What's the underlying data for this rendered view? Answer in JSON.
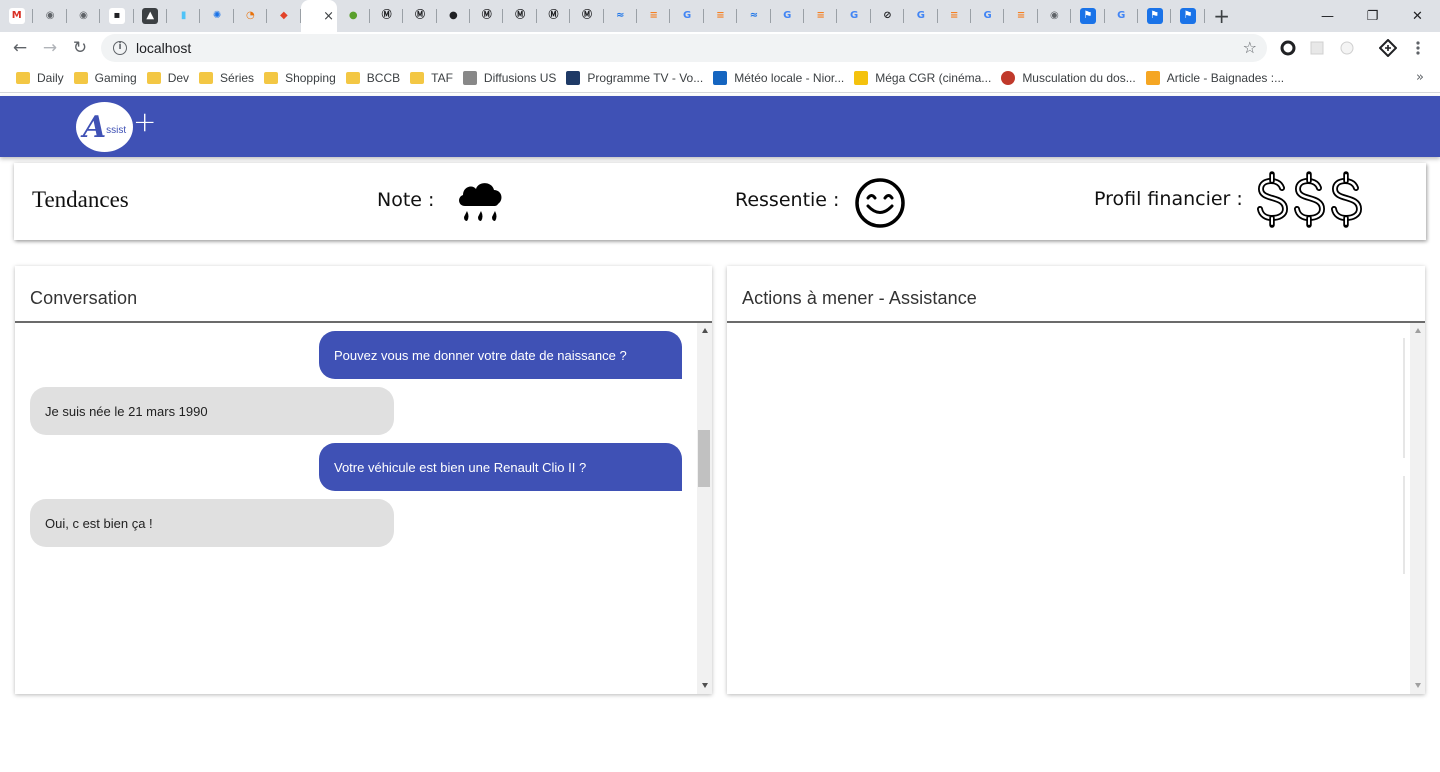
{
  "browser": {
    "tabs": [
      {
        "icon": "gmail-icon",
        "glyph": "M",
        "color": "#d93025",
        "bg": "#ffffff"
      },
      {
        "icon": "globe-icon",
        "glyph": "◉",
        "color": "#5f6368",
        "bg": "transparent"
      },
      {
        "icon": "globe-icon",
        "glyph": "◉",
        "color": "#5f6368",
        "bg": "transparent"
      },
      {
        "icon": "page-icon",
        "glyph": "▪",
        "color": "#202124",
        "bg": "#ffffff"
      },
      {
        "icon": "image-icon",
        "glyph": "▲",
        "color": "#ffffff",
        "bg": "#3c4043"
      },
      {
        "icon": "tube-icon",
        "glyph": "▮",
        "color": "#4fc3f7",
        "bg": "transparent"
      },
      {
        "icon": "chip-icon",
        "glyph": "✺",
        "color": "#1a73e8",
        "bg": "transparent"
      },
      {
        "icon": "clock-fox-icon",
        "glyph": "◔",
        "color": "#e8710a",
        "bg": "transparent"
      },
      {
        "icon": "gitlab-icon",
        "glyph": "◆",
        "color": "#e24329",
        "bg": "transparent"
      },
      {
        "icon": "blank-icon",
        "glyph": "",
        "color": "#5f6368",
        "bg": "transparent"
      },
      {
        "icon": "ball-icon",
        "glyph": "●",
        "color": "#5aa02c",
        "bg": "transparent"
      },
      {
        "icon": "m-circle-icon",
        "glyph": "Ⓜ",
        "color": "#202124",
        "bg": "transparent"
      },
      {
        "icon": "m-circle-icon",
        "glyph": "Ⓜ",
        "color": "#202124",
        "bg": "transparent"
      },
      {
        "icon": "github-icon",
        "glyph": "●",
        "color": "#202124",
        "bg": "transparent"
      },
      {
        "icon": "m-circle-icon",
        "glyph": "Ⓜ",
        "color": "#202124",
        "bg": "transparent"
      },
      {
        "icon": "m-circle-icon",
        "glyph": "Ⓜ",
        "color": "#202124",
        "bg": "transparent"
      },
      {
        "icon": "m-circle-icon",
        "glyph": "Ⓜ",
        "color": "#202124",
        "bg": "transparent"
      },
      {
        "icon": "m-circle-icon",
        "glyph": "Ⓜ",
        "color": "#202124",
        "bg": "transparent"
      },
      {
        "icon": "wave-icon",
        "glyph": "≈",
        "color": "#1a73e8",
        "bg": "transparent"
      },
      {
        "icon": "stackoverflow-icon",
        "glyph": "≡",
        "color": "#f48024",
        "bg": "transparent"
      },
      {
        "icon": "google-icon",
        "glyph": "G",
        "color": "#4285f4",
        "bg": "transparent"
      },
      {
        "icon": "stackoverflow-icon",
        "glyph": "≡",
        "color": "#f48024",
        "bg": "transparent"
      },
      {
        "icon": "wave-icon",
        "glyph": "≈",
        "color": "#1a73e8",
        "bg": "transparent"
      },
      {
        "icon": "google-icon",
        "glyph": "G",
        "color": "#4285f4",
        "bg": "transparent"
      },
      {
        "icon": "stackoverflow-icon",
        "glyph": "≡",
        "color": "#f48024",
        "bg": "transparent"
      },
      {
        "icon": "google-icon",
        "glyph": "G",
        "color": "#4285f4",
        "bg": "transparent"
      },
      {
        "icon": "slash-icon",
        "glyph": "⊘",
        "color": "#202124",
        "bg": "transparent"
      },
      {
        "icon": "google-icon",
        "glyph": "G",
        "color": "#4285f4",
        "bg": "transparent"
      },
      {
        "icon": "stackoverflow-icon",
        "glyph": "≡",
        "color": "#f48024",
        "bg": "transparent"
      },
      {
        "icon": "google-icon",
        "glyph": "G",
        "color": "#4285f4",
        "bg": "transparent"
      },
      {
        "icon": "stackoverflow-icon",
        "glyph": "≡",
        "color": "#f48024",
        "bg": "transparent"
      },
      {
        "icon": "globe-icon",
        "glyph": "◉",
        "color": "#5f6368",
        "bg": "transparent"
      },
      {
        "icon": "flag-icon",
        "glyph": "⚑",
        "color": "#ffffff",
        "bg": "#1a73e8"
      },
      {
        "icon": "google-icon",
        "glyph": "G",
        "color": "#4285f4",
        "bg": "transparent"
      },
      {
        "icon": "flag-icon",
        "glyph": "⚑",
        "color": "#ffffff",
        "bg": "#1a73e8"
      },
      {
        "icon": "flag-icon",
        "glyph": "⚑",
        "color": "#ffffff",
        "bg": "#1a73e8"
      }
    ],
    "active_tab_index": 9,
    "tab_close": "×",
    "new_tab": "+",
    "window_controls": {
      "minimize": "—",
      "maximize": "❐",
      "close": "✕"
    },
    "nav": {
      "back": "←",
      "forward": "→",
      "reload": "↻"
    },
    "url": "localhost",
    "star": "☆",
    "more_bookmarks": "»",
    "bookmarks": [
      {
        "label": "Daily",
        "icon": "folder"
      },
      {
        "label": "Gaming",
        "icon": "folder"
      },
      {
        "label": "Dev",
        "icon": "folder"
      },
      {
        "label": "Séries",
        "icon": "folder"
      },
      {
        "label": "Shopping",
        "icon": "folder"
      },
      {
        "label": "BCCB",
        "icon": "folder"
      },
      {
        "label": "TAF",
        "icon": "folder"
      },
      {
        "label": "Diffusions US",
        "icon": "grid",
        "color": "#888888"
      },
      {
        "label": "Programme TV - Vo...",
        "icon": "tv",
        "color": "#1f3a66"
      },
      {
        "label": "Météo locale - Nior...",
        "icon": "weather",
        "color": "#1565c0"
      },
      {
        "label": "Méga CGR (cinéma...",
        "icon": "cgr",
        "color": "#f4c20d"
      },
      {
        "label": "Musculation du dos...",
        "icon": "muscle",
        "color": "#c0392b"
      },
      {
        "label": "Article - Baignades :...",
        "icon": "article",
        "color": "#f5a623"
      }
    ]
  },
  "app": {
    "logo_letter": "A",
    "logo_text": "ssist",
    "logo_plus": "+",
    "trends": {
      "title": "Tendances",
      "note_label": "Note :",
      "note_icon": "rain-cloud-icon",
      "feeling_label": "Ressentie :",
      "feeling_icon": "smile-icon",
      "financial_label": "Profil financier :",
      "financial_icon": "dollar-icon",
      "financial_count": 3
    },
    "conversation": {
      "title": "Conversation",
      "messages": [
        {
          "from": "agent",
          "text": "Pouvez vous me donner votre date de naissance ?"
        },
        {
          "from": "client",
          "text": "Je suis née le 21 mars 1990"
        },
        {
          "from": "agent",
          "text": "Votre véhicule est bien une Renault Clio II ?"
        },
        {
          "from": "client",
          "text": "Oui, c est bien ça !"
        }
      ]
    },
    "actions": {
      "title": "Actions à mener - Assistance"
    },
    "colors": {
      "primary": "#3f51b5",
      "client_bubble": "#e0e0e0"
    }
  }
}
